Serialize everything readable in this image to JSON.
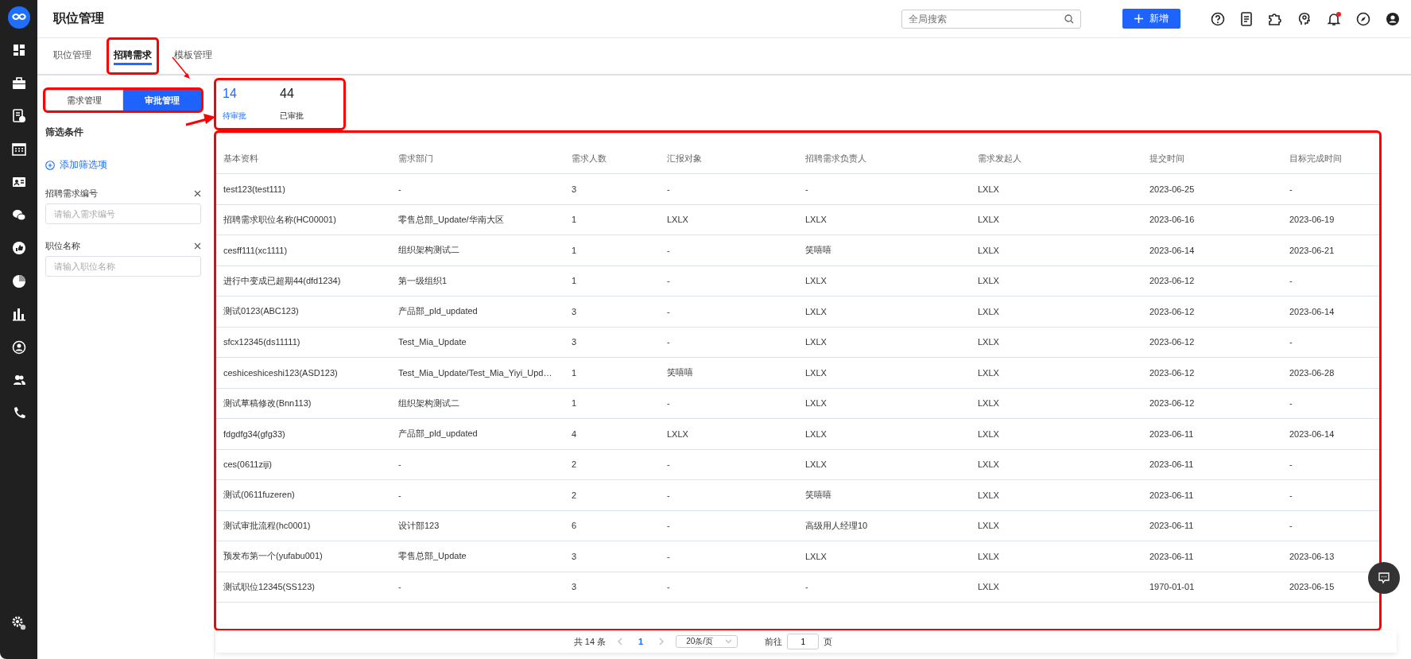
{
  "header": {
    "title": "职位管理",
    "search": {
      "placeholder": "全局搜索"
    },
    "add_button": "新增",
    "notification_dot": true
  },
  "tabs": [
    {
      "label": "职位管理",
      "selected": false,
      "highlighted": false
    },
    {
      "label": "招聘需求",
      "selected": true,
      "highlighted": true
    },
    {
      "label": "模板管理",
      "selected": false,
      "highlighted": false
    }
  ],
  "mode_switch": {
    "highlighted": true,
    "options": [
      {
        "label": "需求管理",
        "selected": false
      },
      {
        "label": "审批管理",
        "selected": true
      }
    ]
  },
  "filters": {
    "title": "筛选条件",
    "add_filter": "添加筛选项",
    "fields": [
      {
        "label": "招聘需求编号",
        "placeholder": "请输入需求编号"
      },
      {
        "label": "职位名称",
        "placeholder": "请输入职位名称"
      }
    ]
  },
  "stats": {
    "highlighted": true,
    "items": [
      {
        "value": "14",
        "label": "待审批",
        "selected": true
      },
      {
        "value": "44",
        "label": "已审批",
        "selected": false
      }
    ]
  },
  "table": {
    "highlighted": true,
    "columns": [
      "基本资料",
      "需求部门",
      "需求人数",
      "汇报对象",
      "招聘需求负责人",
      "需求发起人",
      "提交时间",
      "目标完成时间"
    ],
    "rows": [
      [
        "test123(test111)",
        "-",
        "3",
        "-",
        "-",
        "LXLX",
        "2023-06-25",
        "-"
      ],
      [
        "招聘需求职位名称(HC00001)",
        "零售总部_Update/华南大区",
        "1",
        "LXLX",
        "LXLX",
        "LXLX",
        "2023-06-16",
        "2023-06-19"
      ],
      [
        "cesff111(xc1111)",
        "组织架构测试二",
        "1",
        "-",
        "笑嘻嘻",
        "LXLX",
        "2023-06-14",
        "2023-06-21"
      ],
      [
        "进行中变成已超期44(dfd1234)",
        "第一级组织1",
        "1",
        "-",
        "LXLX",
        "LXLX",
        "2023-06-12",
        "-"
      ],
      [
        "测试0123(ABC123)",
        "产品部_pld_updated",
        "3",
        "-",
        "LXLX",
        "LXLX",
        "2023-06-12",
        "2023-06-14"
      ],
      [
        "sfcx12345(ds11111)",
        "Test_Mia_Update",
        "3",
        "-",
        "LXLX",
        "LXLX",
        "2023-06-12",
        "-"
      ],
      [
        "ceshiceshiceshi123(ASD123)",
        "Test_Mia_Update/Test_Mia_Yiyi_Upd…",
        "1",
        "笑嘻嘻",
        "LXLX",
        "LXLX",
        "2023-06-12",
        "2023-06-28"
      ],
      [
        "测试草稿修改(Bnn113)",
        "组织架构测试二",
        "1",
        "-",
        "LXLX",
        "LXLX",
        "2023-06-12",
        "-"
      ],
      [
        "fdgdfg34(gfg33)",
        "产品部_pld_updated",
        "4",
        "LXLX",
        "LXLX",
        "LXLX",
        "2023-06-11",
        "2023-06-14"
      ],
      [
        "ces(0611ziji)",
        "-",
        "2",
        "-",
        "LXLX",
        "LXLX",
        "2023-06-11",
        "-"
      ],
      [
        "测试(0611fuzeren)",
        "-",
        "2",
        "-",
        "笑嘻嘻",
        "LXLX",
        "2023-06-11",
        "-"
      ],
      [
        "测试审批流程(hc0001)",
        "设计部123",
        "6",
        "-",
        "高级用人经理10",
        "LXLX",
        "2023-06-11",
        "-"
      ],
      [
        "预发布第一个(yufabu001)",
        "零售总部_Update",
        "3",
        "-",
        "LXLX",
        "LXLX",
        "2023-06-11",
        "2023-06-13"
      ],
      [
        "测试职位12345(SS123)",
        "-",
        "3",
        "-",
        "-",
        "LXLX",
        "1970-01-01",
        "2023-06-15"
      ]
    ]
  },
  "pagination": {
    "total": "共 14 条",
    "pages": [
      {
        "label": "1",
        "selected": true
      }
    ],
    "page_size": "20条/页",
    "goto_label": "前往",
    "goto_value": "1",
    "goto_suffix": "页"
  },
  "annotation_arrows": [
    {
      "kind": "arrow"
    },
    {
      "kind": "arrow"
    }
  ]
}
